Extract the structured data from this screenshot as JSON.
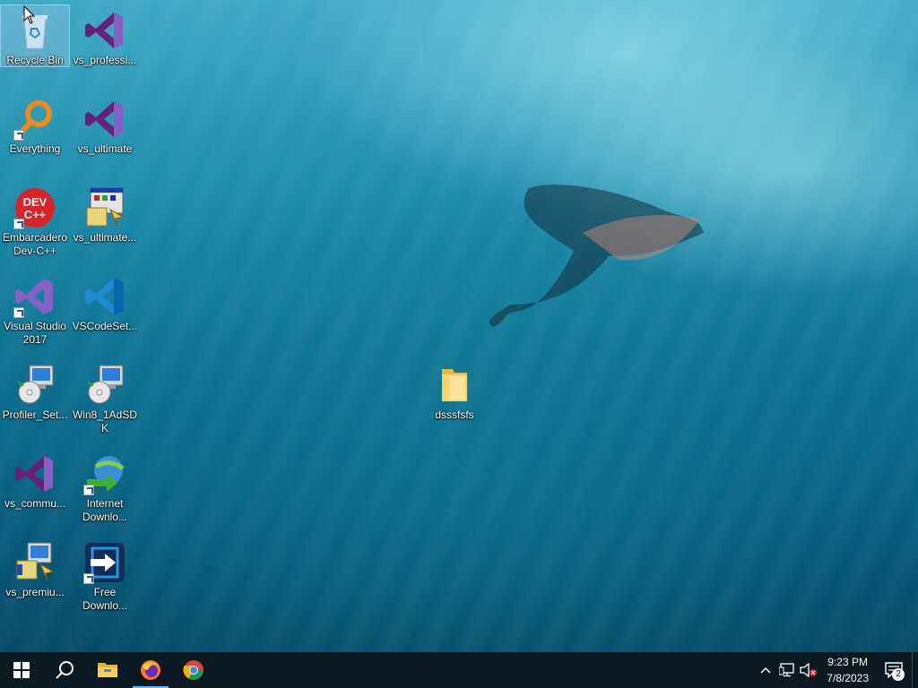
{
  "desktop": {
    "icons": [
      {
        "label": "Recycle Bin",
        "icon": "recycle-bin-icon"
      },
      {
        "label": "vs_professi...",
        "icon": "visual-studio-icon"
      },
      {
        "label": "Everything",
        "icon": "everything-search-icon"
      },
      {
        "label": "vs_ultimate",
        "icon": "visual-studio-icon"
      },
      {
        "label": "Embarcadero Dev-C++",
        "icon": "devcpp-icon"
      },
      {
        "label": "vs_ultimate...",
        "icon": "installer-icon"
      },
      {
        "label": "Visual Studio 2017",
        "icon": "visual-studio-icon"
      },
      {
        "label": "VSCodeSet...",
        "icon": "vscode-icon"
      },
      {
        "label": "Profiler_Set...",
        "icon": "setup-cd-icon"
      },
      {
        "label": "Win8_1AdSDK",
        "icon": "setup-cd-icon"
      },
      {
        "label": "vs_commu...",
        "icon": "visual-studio-icon"
      },
      {
        "label": "Internet Downlo...",
        "icon": "internet-download-manager-icon"
      },
      {
        "label": "vs_premiu...",
        "icon": "installer-icon"
      },
      {
        "label": "Free Downlo...",
        "icon": "free-download-manager-icon"
      },
      {
        "label": "dsssfsfs",
        "icon": "folder-icon"
      }
    ],
    "devcpp_text": "DEV\nC++"
  },
  "taskbar": {
    "items": [
      "start-icon",
      "search-icon",
      "file-explorer-icon",
      "firefox-icon",
      "chrome-icon"
    ]
  },
  "tray": {
    "time": "9:23 PM",
    "date": "7/8/2023",
    "notifications": "2"
  }
}
